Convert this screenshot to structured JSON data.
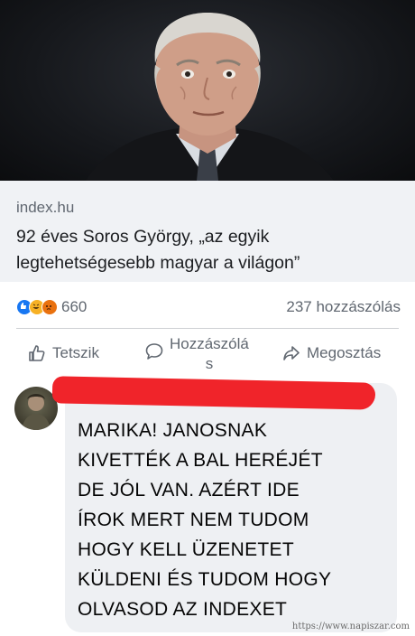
{
  "post": {
    "image_subject": "portrait-photo",
    "link_domain": "index.hu",
    "link_title": "92 éves Soros György, „az egyik legtehetségesebb magyar a világon”"
  },
  "stats": {
    "reaction_icons": [
      "like-reaction-icon",
      "haha-reaction-icon",
      "angry-reaction-icon"
    ],
    "reaction_count": "660",
    "comment_count": "237 hozzászólás"
  },
  "actions": {
    "like_label": "Tetszik",
    "comment_label": "Hozzászólá\ns",
    "share_label": "Megosztás"
  },
  "comment": {
    "author_redacted": true,
    "text": "MARIKA! JANOSNAK\nKIVETTÉK A BAL HERÉJÉT\nDE JÓL VAN. AZÉRT IDE\nÍROK MERT NEM TUDOM\nHOGY KELL ÜZENETET\nKÜLDENI ÉS TUDOM HOGY\nOLVASOD AZ INDEXET"
  },
  "watermark": "https://www.napiszar.com",
  "colors": {
    "redaction": "#f0242a",
    "text_muted": "#606770"
  }
}
